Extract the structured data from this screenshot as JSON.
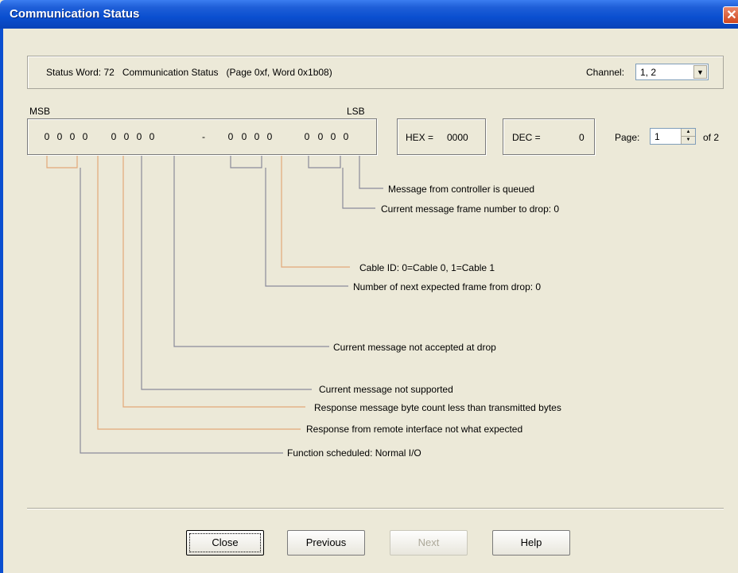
{
  "window": {
    "title": "Communication Status"
  },
  "header": {
    "status_text": "Status Word: 72   Communication Status   (Page 0xf, Word 0x1b08)",
    "channel_label": "Channel:",
    "channel_value": "1, 2"
  },
  "bits": {
    "msb_label": "MSB",
    "lsb_label": "LSB",
    "values": [
      "0",
      "0",
      "0",
      "0",
      "0",
      "0",
      "0",
      "0",
      "0",
      "0",
      "0",
      "0",
      "0",
      "0",
      "0",
      "0"
    ],
    "separator": "-"
  },
  "hex": {
    "label": "HEX =",
    "value": "0000"
  },
  "dec": {
    "label": "DEC =",
    "value": "0"
  },
  "paging": {
    "label": "Page:",
    "value": "1",
    "of": "of 2"
  },
  "descriptions": [
    "Message from controller is queued",
    "Current message frame number to drop: 0",
    "Cable ID:   0=Cable 0,   1=Cable 1",
    "Number of next expected frame from drop: 0",
    "Current message not accepted at drop",
    "Current message not supported",
    "Response message byte count less than transmitted bytes",
    "Response from remote interface not what expected",
    "Function scheduled: Normal I/O"
  ],
  "buttons": {
    "close": "Close",
    "previous": "Previous",
    "next": "Next",
    "help": "Help"
  },
  "colors": {
    "title_bar": "#0a4fd0",
    "leader_orange": "#e2a878",
    "leader_gray": "#8a8a9a"
  }
}
